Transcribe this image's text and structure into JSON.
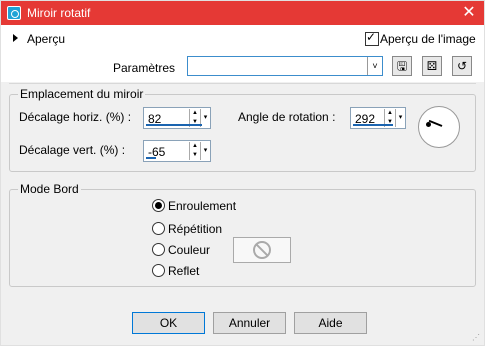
{
  "window": {
    "title": "Miroir rotatif",
    "close": "✕"
  },
  "preview": {
    "toggle_label": "Aperçu",
    "image_preview_label": "Aperçu de l'image",
    "image_preview_checked": true
  },
  "presets": {
    "label": "Paramètres",
    "value": "",
    "dropdown_glyph": "˅",
    "tools": [
      "save-preset-icon",
      "randomize-icon",
      "reset-icon"
    ],
    "tool_glyphs": [
      "🖫",
      "⚄",
      "↺"
    ]
  },
  "mirror_location": {
    "title": "Emplacement du miroir",
    "horiz_label": "Décalage horiz. (%) :",
    "horiz_value": "82",
    "vert_label": "Décalage vert. (%) :",
    "vert_value": "-65",
    "rotation_label": "Angle de rotation :",
    "rotation_value": "292"
  },
  "edge_mode": {
    "title": "Mode Bord",
    "options": [
      "Enroulement",
      "Répétition",
      "Couleur",
      "Reflet"
    ],
    "selected": "Enroulement"
  },
  "buttons": {
    "ok": "OK",
    "cancel": "Annuler",
    "help": "Aide"
  },
  "colors": {
    "titlebar": "#e53935",
    "accent": "#1a64b0"
  }
}
